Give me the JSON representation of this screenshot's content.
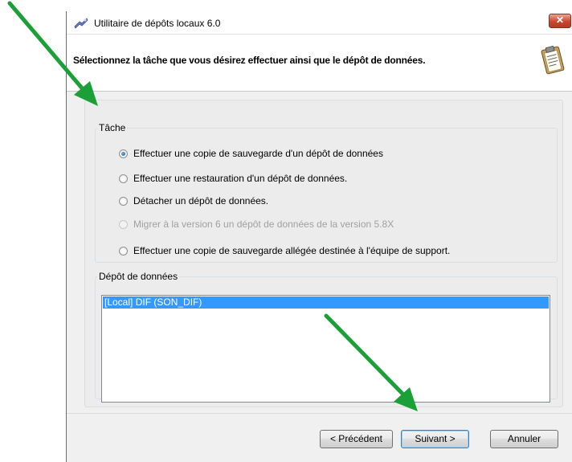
{
  "window": {
    "title": "Utilitaire de dépôts locaux 6.0",
    "close_label": "✕"
  },
  "header": {
    "instruction": "Sélectionnez la tâche que vous désirez effectuer ainsi que le dépôt de données."
  },
  "task_group": {
    "legend": "Tâche",
    "options": [
      {
        "label": "Effectuer une copie de sauvegarde d'un dépôt de données",
        "checked": true,
        "enabled": true
      },
      {
        "label": "Effectuer une restauration d'un dépôt de données.",
        "checked": false,
        "enabled": true
      },
      {
        "label": "Détacher un dépôt de données.",
        "checked": false,
        "enabled": true
      },
      {
        "label": "Migrer à la version 6 un dépôt de données de la version 5.8X",
        "checked": false,
        "enabled": false
      },
      {
        "label": "Effectuer une copie de sauvegarde allégée destinée à l'équipe de support.",
        "checked": false,
        "enabled": true
      }
    ]
  },
  "datastore_group": {
    "legend": "Dépôt de données",
    "items": [
      {
        "label": "[Local] DIF (SON_DIF)",
        "selected": true
      }
    ]
  },
  "buttons": {
    "previous": "< Précédent",
    "next": "Suivant >",
    "cancel": "Annuler"
  },
  "colors": {
    "selection": "#3399ff",
    "arrow": "#1aa037"
  }
}
